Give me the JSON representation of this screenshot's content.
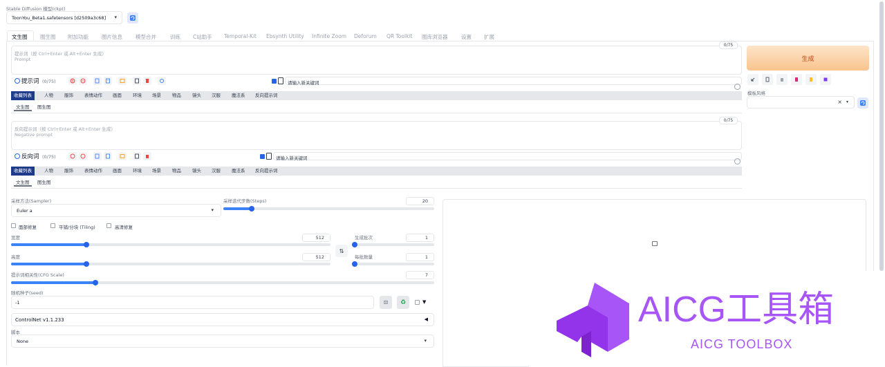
{
  "model": {
    "label": "Stable Diffusion 模型(ckpt)",
    "value": "ToonYou_Beta1.safetensors [d2509a3c68]"
  },
  "tabs": [
    "文生图",
    "图生图",
    "附加功能",
    "图片信息",
    "模型合并",
    "训练",
    "C站助手",
    "Temporal-Kit",
    "Ebsynth Utility",
    "Infinite Zoom",
    "Deforum",
    "QR Toolkit",
    "图库浏览器",
    "设置",
    "扩展"
  ],
  "prompt": {
    "placeholder_line1": "提示词（按 Ctrl+Enter 或 Alt+Enter 生成）",
    "placeholder_line2": "Prompt",
    "counter": "0/75",
    "section_title": "提示词",
    "section_count": "(0/75)",
    "keyword_placeholder": "请输入新关键词"
  },
  "negative": {
    "placeholder_line1": "反向提示词（按 Ctrl+Enter 或 Alt+Enter 生成）",
    "placeholder_line2": "Negative prompt",
    "counter": "0/75",
    "section_title": "反向词",
    "section_count": "(0/75)",
    "keyword_placeholder": "请输入新关键词"
  },
  "tag_tabs": [
    "收藏列表",
    "人物",
    "服饰",
    "表情动作",
    "画面",
    "环境",
    "场景",
    "物品",
    "镜头",
    "汉服",
    "魔法系",
    "反向提示词"
  ],
  "sub_tabs": [
    "文生图",
    "图生图"
  ],
  "generate_label": "生成",
  "styles_label": "模板风格",
  "sampler": {
    "label": "采样方法(Sampler)",
    "value": "Euler a"
  },
  "steps": {
    "label": "采样迭代步数(Steps)",
    "value": "20",
    "fraction": 0.133
  },
  "checks": {
    "restore_faces": "面部修复",
    "tiling": "平铺/分块 (Tiling)",
    "hires": "高清修复"
  },
  "width": {
    "label": "宽度",
    "value": "512",
    "fraction": 0.236
  },
  "height": {
    "label": "高度",
    "value": "512",
    "fraction": 0.236
  },
  "batch_count": {
    "label": "生成批次",
    "value": "1",
    "fraction": 0.0
  },
  "batch_size": {
    "label": "每批数量",
    "value": "1",
    "fraction": 0.0
  },
  "cfg": {
    "label": "提示词相关性(CFG Scale)",
    "value": "7",
    "fraction": 0.2
  },
  "seed": {
    "label": "随机种子(seed)",
    "value": "-1"
  },
  "controlnet_label": "ControlNet v1.1.233",
  "script": {
    "label": "脚本",
    "value": "None"
  },
  "watermark": {
    "title": "AICG工具箱",
    "subtitle": "AICG TOOLBOX",
    "color": "#a855f7"
  },
  "colors": {
    "accent": "#2563eb",
    "generate": "#f59e0b",
    "tag_active": "#1e3a8a"
  }
}
